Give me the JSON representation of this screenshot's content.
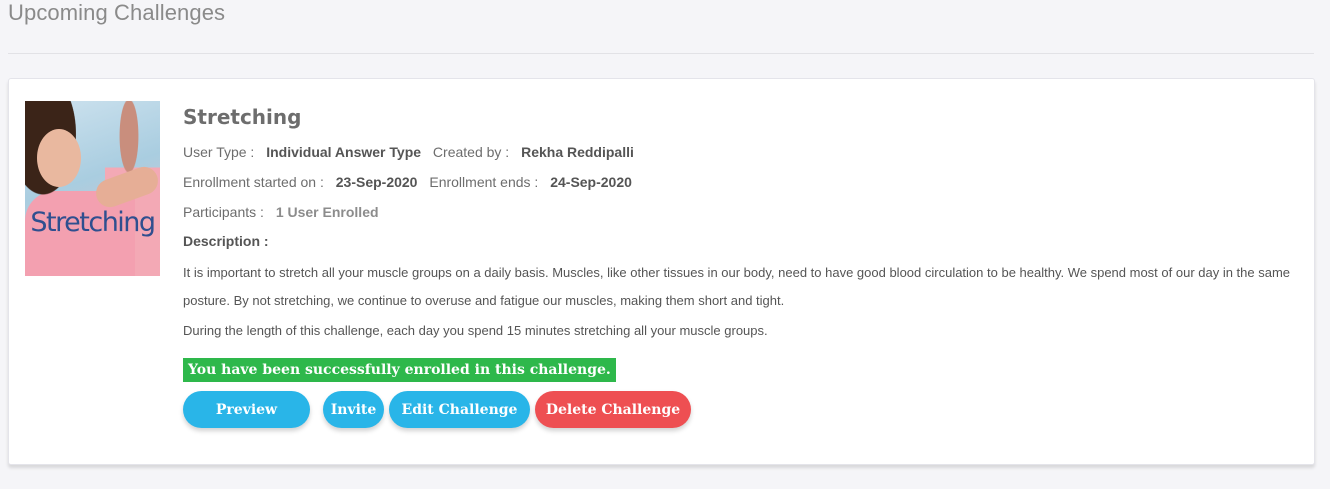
{
  "page": {
    "title": "Upcoming Challenges"
  },
  "challenge": {
    "image_text": "Stretching",
    "name": "Stretching",
    "user_type_label": "User Type :",
    "user_type_value": "Individual Answer Type",
    "created_by_label": "Created by :",
    "created_by_value": "Rekha Reddipalli",
    "enroll_start_label": "Enrollment started on :",
    "enroll_start_value": "23-Sep-2020",
    "enroll_end_label": "Enrollment ends :",
    "enroll_end_value": "24-Sep-2020",
    "participants_label": "Participants :",
    "participants_value": "1 User Enrolled",
    "description_label": "Description :",
    "description_p1": "It is important to stretch all your muscle groups on a daily basis. Muscles, like other tissues in our body, need to have good blood circulation to be healthy.  We spend most of our day in the same posture.  By not stretching, we continue to overuse and fatigue our muscles, making them short and tight.",
    "description_p2": "During the length of this challenge, each day you spend 15 minutes stretching all your muscle groups.",
    "status_message": "You have been successfully enrolled in this challenge."
  },
  "actions": {
    "preview": "Preview",
    "invite": "Invite",
    "edit": "Edit Challenge",
    "delete": "Delete Challenge"
  },
  "colors": {
    "primary_button": "#29b5e8",
    "danger_button": "#ee4f52",
    "success_banner": "#2eb84b"
  }
}
